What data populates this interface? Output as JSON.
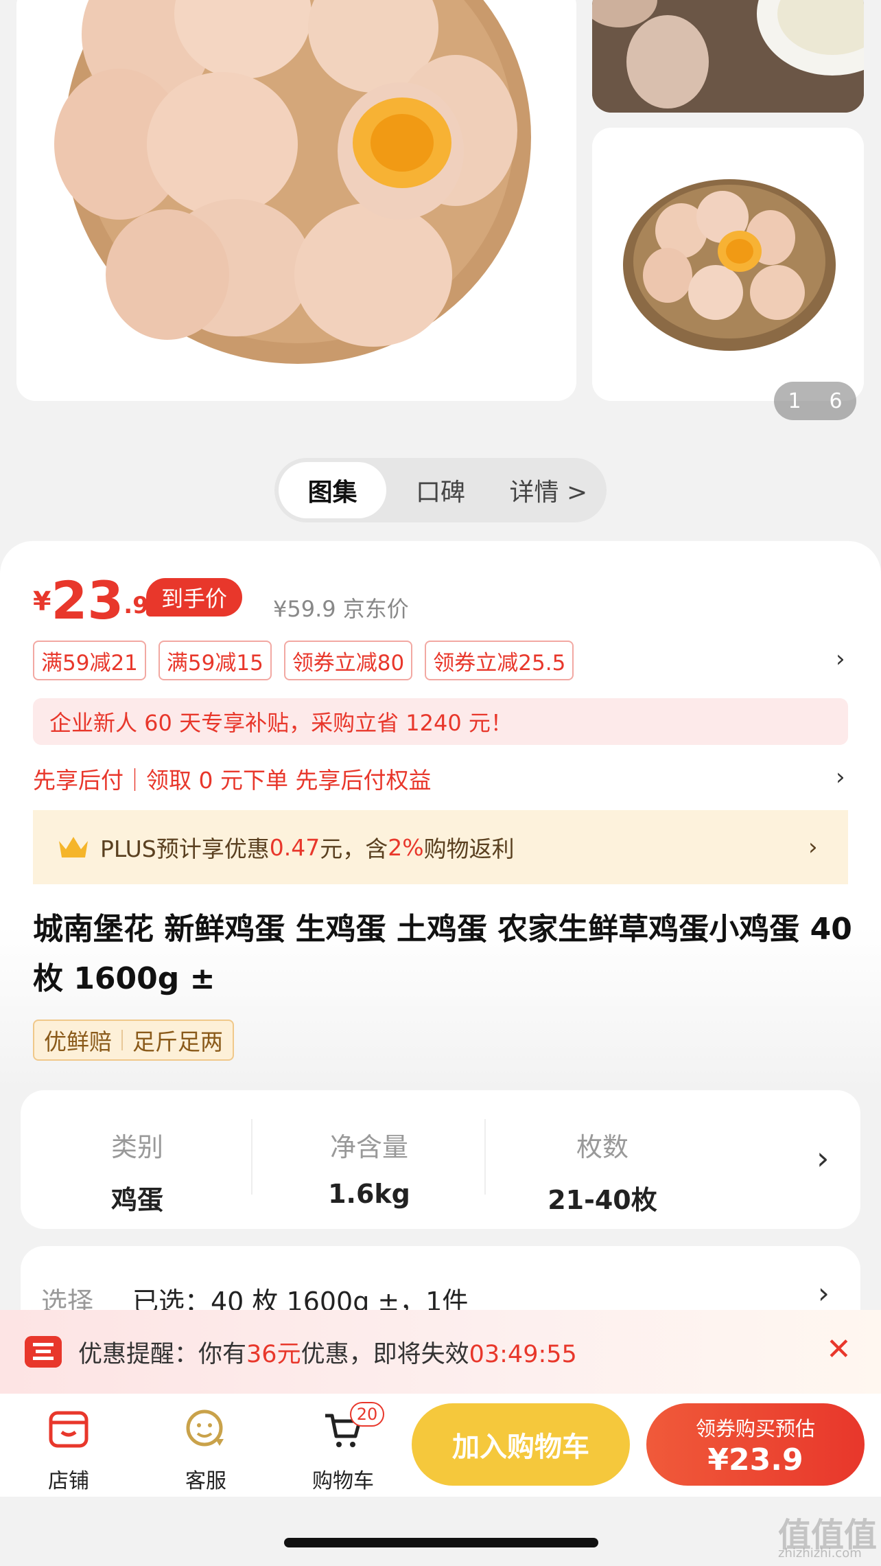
{
  "gallery": {
    "page_current": "1",
    "page_total": "6",
    "tabs": [
      "图集",
      "口碑",
      "详情 >"
    ]
  },
  "price": {
    "symbol": "¥",
    "integer": "23",
    "decimal": ".9",
    "tag": "到手价",
    "jd_price": "¥59.9 京东价"
  },
  "coupons": [
    "满59减21",
    "满59减15",
    "领券立减80",
    "领券立减25.5"
  ],
  "notice": "企业新人 60 天专享补贴，采购立省 1240 元！",
  "paylater": "先享后付｜领取 0 元下单 先享后付权益",
  "plus": {
    "prefix": "PLUS预计享优惠",
    "amount": "0.47",
    "mid": "元，含",
    "pct": "2%",
    "suffix": "购物返利"
  },
  "title": "城南堡花 新鲜鸡蛋 生鸡蛋 土鸡蛋 农家生鲜草鸡蛋小鸡蛋 40 枚 1600g ±",
  "badges": [
    "优鲜赔",
    "足斤足两"
  ],
  "specs": [
    {
      "key": "类别",
      "value": "鸡蛋"
    },
    {
      "key": "净含量",
      "value": "1.6kg"
    },
    {
      "key": "枚数",
      "value": "21-40枚"
    }
  ],
  "selection": {
    "label": "选择",
    "value": "已选：40 枚 1600g ±，1件"
  },
  "promo": {
    "p1": "优惠提醒：你有",
    "amount": "36",
    "p2": "元",
    "p3": "优惠，即将失效",
    "countdown": "03:49:55"
  },
  "bottom": {
    "shop": "店铺",
    "service": "客服",
    "cart": "购物车",
    "cart_count": "20",
    "add_to_cart": "加入购物车",
    "buy_line1": "领券购买预估",
    "buy_line2": "¥23.9"
  },
  "watermark": {
    "main": "值值值",
    "sub": "zhizhizhi.com"
  },
  "colors": {
    "accent": "#e8372b",
    "gold": "#f5c83c",
    "plus_bg": "#fdf2dc"
  }
}
